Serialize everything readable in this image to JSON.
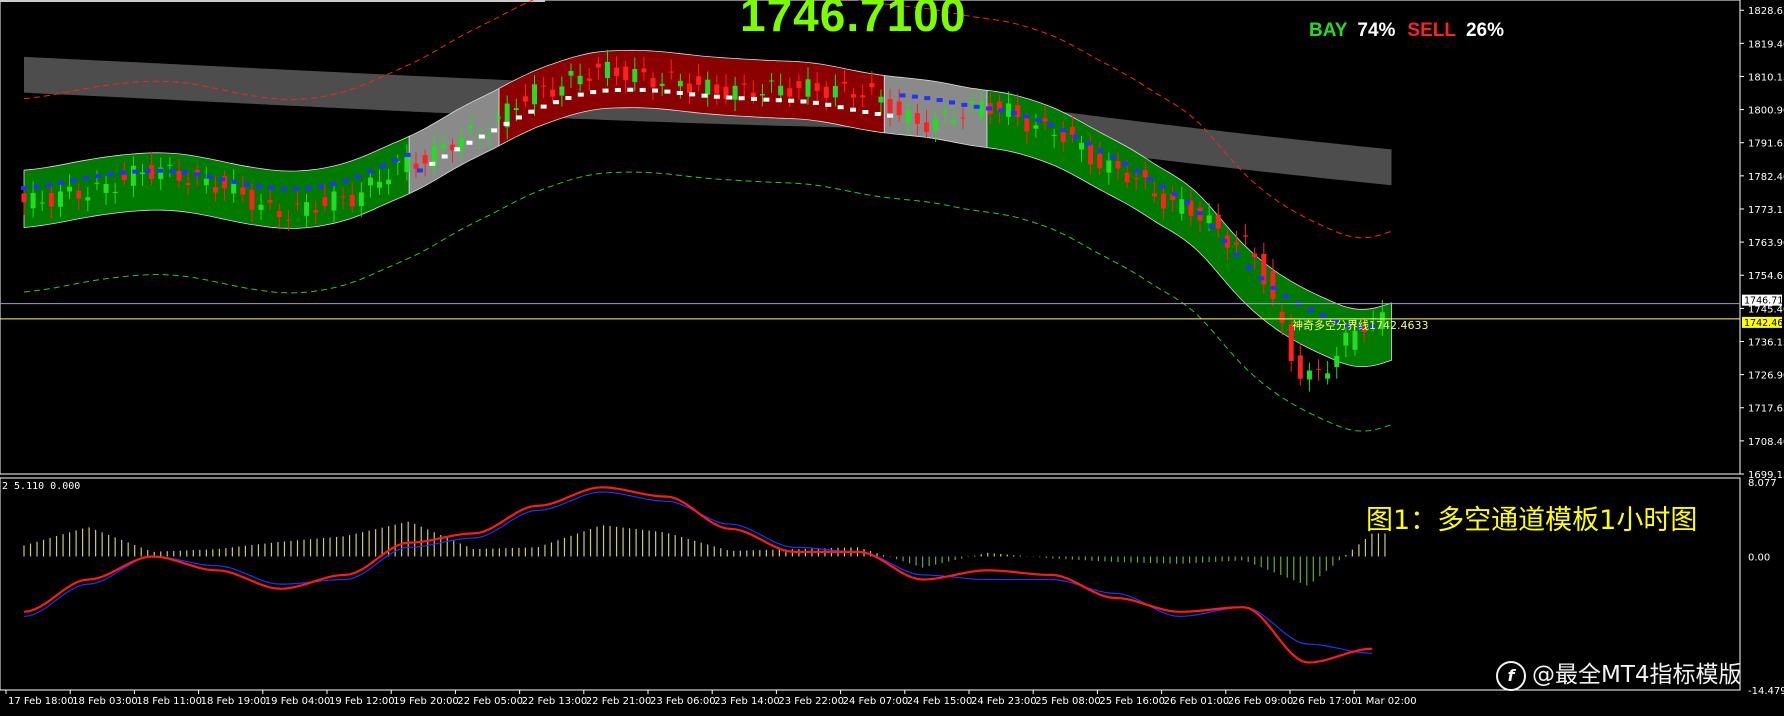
{
  "header": {
    "price_display": "1746.7100",
    "buy_label": "BAY",
    "buy_pct": "74%",
    "sell_label": "SELL",
    "sell_pct": "26%"
  },
  "caption": "图1：多空通道模板1小时图",
  "watermark": "@最全MT4指标模版",
  "colors": {
    "background": "#000000",
    "band_green": "#007a00",
    "band_red": "#8b0000",
    "band_gray": "#8a8a8a",
    "band_dark_gray": "#5a5a5a",
    "bull_candle": "#22dd22",
    "bear_candle": "#ff2020",
    "macd_main": "#ff1a1a",
    "macd_signal": "#2233ff",
    "histogram": "#cccc66",
    "ask_line": "#a0a0c0",
    "boundary_line": "#ffff66"
  },
  "chart_data": [
    {
      "type": "line",
      "panel": "main",
      "y_ticks": [
        "1828.65",
        "1819.40",
        "1810.15",
        "1800.90",
        "1791.65",
        "1782.40",
        "1773.15",
        "1763.90",
        "1754.65",
        "1745.40",
        "1736.15",
        "1726.90",
        "1717.65",
        "1708.40",
        "1699.15"
      ],
      "ylim": [
        1699.15,
        1831.5
      ],
      "current_price_label": "1746.71",
      "boundary_price_label": "1742.46",
      "boundary_text": "神奇多空分界线1742.4633",
      "x_ticks": [
        "17 Feb 18:00",
        "18 Feb 03:00",
        "18 Feb 11:00",
        "18 Feb 19:00",
        "19 Feb 04:00",
        "19 Feb 12:00",
        "19 Feb 20:00",
        "22 Feb 05:00",
        "22 Feb 13:00",
        "22 Feb 21:00",
        "23 Feb 06:00",
        "23 Feb 14:00",
        "23 Feb 22:00",
        "24 Feb 07:00",
        "24 Feb 15:00",
        "24 Feb 23:00",
        "25 Feb 08:00",
        "25 Feb 16:00",
        "26 Feb 01:00",
        "26 Feb 09:00",
        "26 Feb 17:00",
        "1 Mar 02:00"
      ],
      "price_path": [
        {
          "x": 0,
          "y": 1775
        },
        {
          "x": 1,
          "y": 1778
        },
        {
          "x": 2,
          "y": 1784
        },
        {
          "x": 3,
          "y": 1780
        },
        {
          "x": 4,
          "y": 1772
        },
        {
          "x": 5,
          "y": 1776
        },
        {
          "x": 6,
          "y": 1786
        },
        {
          "x": 7,
          "y": 1794
        },
        {
          "x": 8,
          "y": 1806
        },
        {
          "x": 9,
          "y": 1812
        },
        {
          "x": 10,
          "y": 1809
        },
        {
          "x": 11,
          "y": 1806
        },
        {
          "x": 12,
          "y": 1807
        },
        {
          "x": 13,
          "y": 1806
        },
        {
          "x": 14,
          "y": 1797
        },
        {
          "x": 15,
          "y": 1802
        },
        {
          "x": 16,
          "y": 1795
        },
        {
          "x": 17,
          "y": 1784
        },
        {
          "x": 18,
          "y": 1774
        },
        {
          "x": 19,
          "y": 1763
        },
        {
          "x": 20,
          "y": 1726
        },
        {
          "x": 21,
          "y": 1742
        }
      ],
      "channel_segments": [
        {
          "color": "green",
          "from": 0,
          "to": 6
        },
        {
          "color": "gray",
          "from": 6,
          "to": 7.4
        },
        {
          "color": "red",
          "from": 7.4,
          "to": 13.4
        },
        {
          "color": "gray",
          "from": 13.4,
          "to": 15
        },
        {
          "color": "green",
          "from": 15,
          "to": 21.3
        }
      ]
    },
    {
      "type": "line",
      "panel": "oscillator",
      "label": "2 5.110 0.000",
      "y_ticks": [
        "8.077",
        "0.00",
        "-14.479"
      ],
      "ylim": [
        -14.479,
        8.077
      ],
      "series": [
        {
          "values": [
            -6.0,
            -2.5,
            0.0,
            -1.5,
            -3.5,
            -2.0,
            1.5,
            2.5,
            5.5,
            7.5,
            6.5,
            3.0,
            0.5,
            0.5,
            -2.5,
            -1.5,
            -2.0,
            -4.5,
            -6.0,
            -5.5,
            -11.5,
            -10.0
          ]
        },
        {
          "values": [
            -6.5,
            -3.0,
            0.0,
            -1.0,
            -3.0,
            -2.5,
            1.0,
            2.0,
            5.0,
            7.0,
            6.0,
            3.5,
            1.0,
            0.5,
            -2.0,
            -2.5,
            -2.5,
            -4.0,
            -6.5,
            -5.5,
            -9.5,
            -10.5
          ]
        }
      ],
      "histogram": [
        1.2,
        3.2,
        0.5,
        0.8,
        1.6,
        2.2,
        3.8,
        0.8,
        1.0,
        3.4,
        2.6,
        0.6,
        0.8,
        1.0,
        -1.2,
        0.4,
        -0.2,
        -0.6,
        -0.8,
        -0.4,
        -3.2,
        2.5
      ]
    }
  ]
}
